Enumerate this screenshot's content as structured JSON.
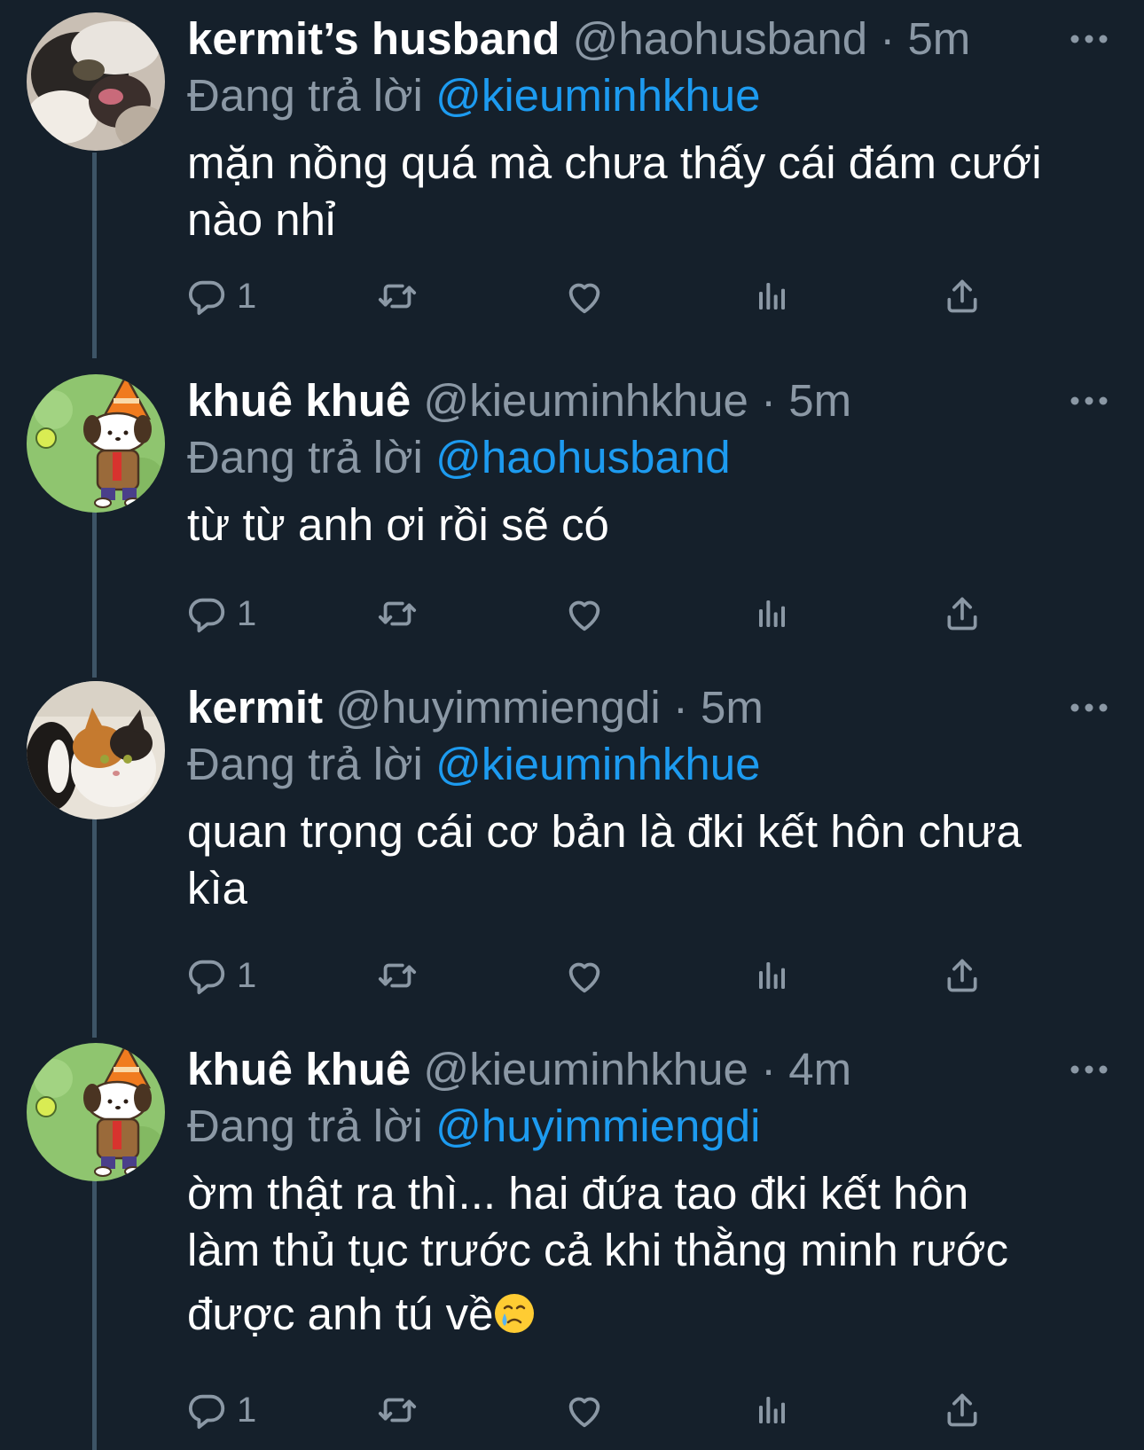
{
  "reply_prefix": "Đang trả lời",
  "tweets": [
    {
      "display_name": "kermit’s husband",
      "handle": "@haohusband",
      "separator": "·",
      "time": "5m",
      "reply_to": "@kieuminhkhue",
      "lines": [
        "mặn nồng quá mà chưa thấy cái đám cưới",
        "nào nhỉ"
      ],
      "reply_count": "1",
      "avatar": "cat-blurry"
    },
    {
      "display_name": "khuê khuê",
      "handle": "@kieuminhkhue",
      "separator": "·",
      "time": "5m",
      "reply_to": "@haohusband",
      "lines": [
        "từ từ anh ơi rồi sẽ có"
      ],
      "reply_count": "1",
      "avatar": "dog-cone"
    },
    {
      "display_name": "kermit",
      "handle": "@huyimmiengdi",
      "separator": "·",
      "time": "5m",
      "reply_to": "@kieuminhkhue",
      "lines": [
        "quan trọng cái cơ bản là đki kết hôn chưa",
        "kìa"
      ],
      "reply_count": "1",
      "avatar": "cat-calico"
    },
    {
      "display_name": "khuê khuê",
      "handle": "@kieuminhkhue",
      "separator": "·",
      "time": "4m",
      "reply_to": "@huyimmiengdi",
      "lines": [
        "ờm thật ra thì... hai đứa tao đki kết hôn",
        "làm thủ tục trước cả khi thằng minh rước",
        "được anh tú về"
      ],
      "emoji": "crying-face",
      "reply_count": "1",
      "avatar": "dog-cone"
    }
  ],
  "icons": [
    "reply-icon",
    "retweet-icon",
    "like-icon",
    "analytics-icon",
    "share-icon",
    "more-icon"
  ],
  "colors": {
    "background": "#15202b",
    "text": "#ffffff",
    "muted": "#8b98a5",
    "link": "#1d9bf0",
    "thread": "#3d5466"
  }
}
